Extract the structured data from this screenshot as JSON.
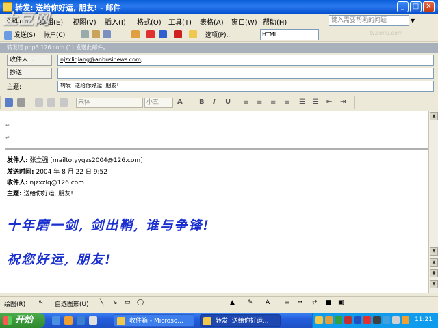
{
  "window": {
    "title": "转发: 送给你好运, 朋友! - 邮件"
  },
  "title_buttons": {
    "minimize": "_",
    "maximize": "□",
    "close": "✕"
  },
  "menubar": {
    "items": [
      "文件(F)",
      "编辑(E)",
      "视图(V)",
      "插入(I)",
      "格式(O)",
      "工具(T)",
      "表格(A)",
      "窗口(W)",
      "帮助(H)"
    ],
    "help_placeholder": "键入需要帮助的问题"
  },
  "toolbar": {
    "send": "发送(S)",
    "accounts": "帐户(C)",
    "options": "选项(P)...",
    "format": "HTML"
  },
  "infobar": {
    "text": "转发过 pop3.126.com (1) 发送此邮件。"
  },
  "headers": {
    "to_label": "收件人...",
    "to_value": "njzxliqiang@anbusinews.com",
    "to_suffix": ";",
    "cc_label": "抄送...",
    "cc_value": "",
    "subject_label": "主题:",
    "subject_value": "转发: 送给你好运, 朋友!"
  },
  "format_toolbar": {
    "font": "宋体",
    "size": "小五",
    "bold": "B",
    "italic": "I",
    "underline": "U"
  },
  "message": {
    "from_label": "发件人:",
    "from_value": "张立强 [mailto:yygzs2004@126.com]",
    "sent_label": "发送时间:",
    "sent_value": "2004 年 8 月 22 日 9:52",
    "to_label": "收件人:",
    "to_value": "njzxzlq@126.com",
    "subject_label": "主题:",
    "subject_value": "送给你好运, 朋友!",
    "line1": "十年磨一剑, 剑出鞘, 谁与争锋!",
    "line2": "祝您好运, 朋友!"
  },
  "drawbar": {
    "draw": "绘图(R)",
    "autoshapes": "自选图形(U)"
  },
  "taskbar": {
    "start": "开始",
    "task1": "收件箱 - Microso...",
    "task2": "转发: 送给你好运...",
    "clock": "11:21"
  },
  "watermark": {
    "logo": "土豆网",
    "url": "tv.sohu.com"
  },
  "colors": {
    "title_blue": "#0a5fd8",
    "body_text_blue": "#1a2fd0",
    "start_green": "#3c9a3b",
    "tray_blue": "#0f9cec"
  }
}
